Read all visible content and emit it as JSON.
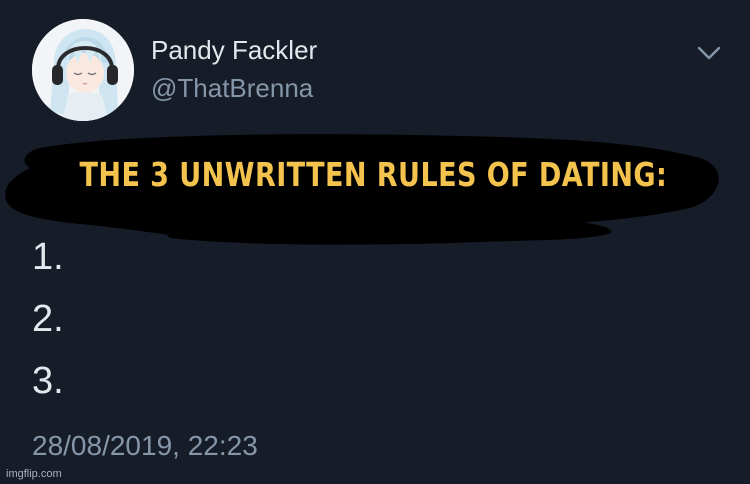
{
  "tweet": {
    "author": {
      "display_name": "Pandy Fackler",
      "handle": "@ThatBrenna",
      "avatar": "anime-girl-with-headphones-avatar"
    },
    "headline": "THE 3 UNWRITTEN RULES OF DATING:",
    "rules": [
      "1.",
      "2.",
      "3."
    ],
    "timestamp": "28/08/2019, 22:23",
    "menu_icon": "chevron-down-icon"
  },
  "watermark": "imgflip.com",
  "colors": {
    "background": "#161d29",
    "headline": "#f4c34e",
    "primary_text": "#e4e7eb",
    "secondary_text": "#8596a8"
  }
}
